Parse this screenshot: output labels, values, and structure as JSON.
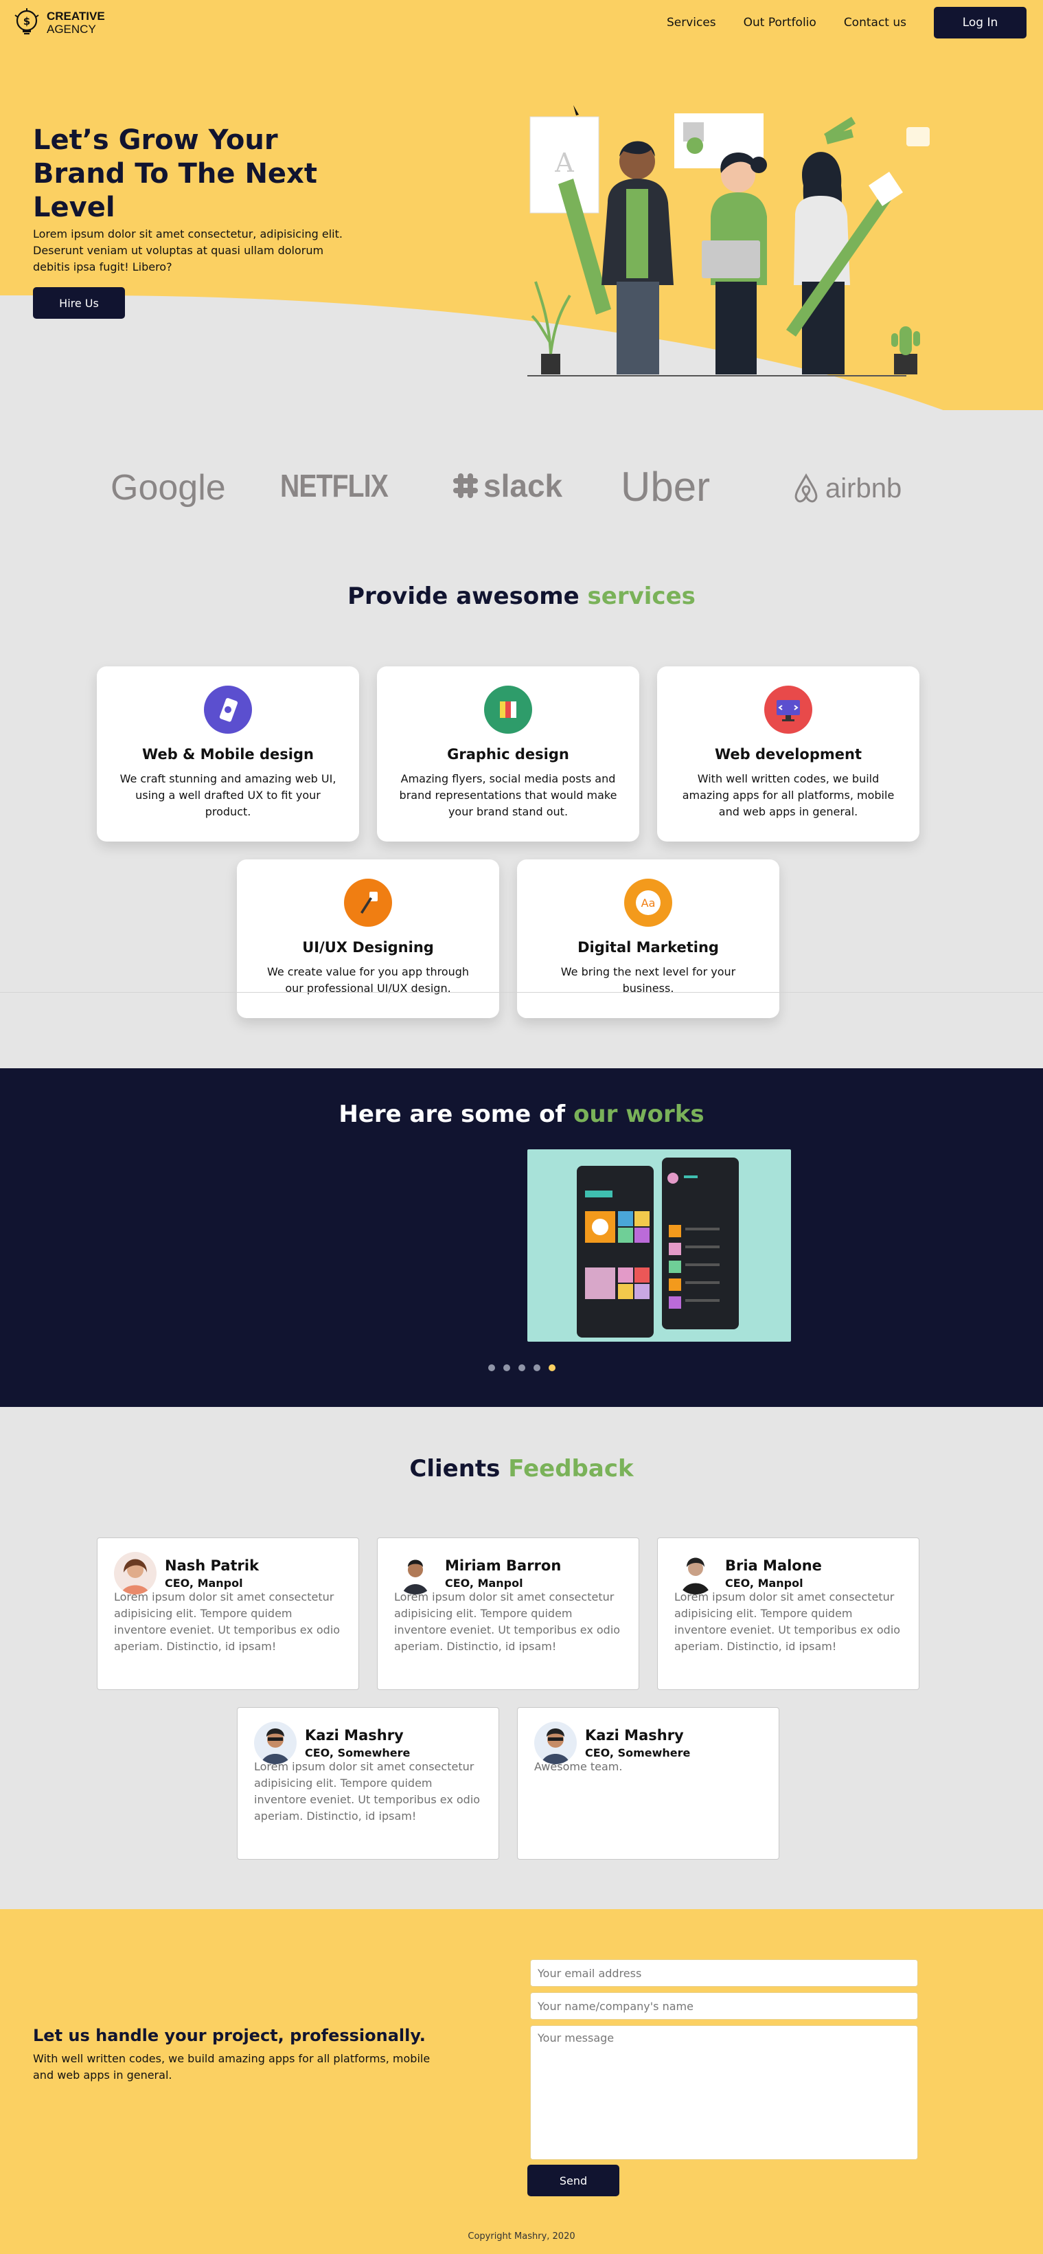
{
  "colors": {
    "primary": "#fbd062",
    "dark": "#111430",
    "accent": "#7ab259",
    "background": "#e5e5e5"
  },
  "brand": {
    "line1": "CREATIVE",
    "line2": "AGENCY",
    "icon": "lightbulb-logo-icon"
  },
  "nav": {
    "links": [
      "Services",
      "Out Portfolio",
      "Contact us"
    ],
    "login": "Log In"
  },
  "hero": {
    "title": "Let’s Grow Your Brand To The Next Level",
    "text": "Lorem ipsum dolor sit amet consectetur, adipisicing elit. Deserunt veniam ut voluptas at quasi ullam dolorum debitis ipsa fugit! Libero?",
    "button": "Hire Us"
  },
  "brands": [
    "Google",
    "NETFLIX",
    "slack",
    "Uber",
    "airbnb"
  ],
  "services": {
    "title_main": "Provide awesome ",
    "title_accent": "services",
    "items": [
      {
        "title": "Web & Mobile design",
        "text": "We craft stunning and amazing web UI, using a well drafted UX to fit your product.",
        "icon": "mobile-design-icon",
        "color": "#5b4fcf"
      },
      {
        "title": "Graphic design",
        "text": "Amazing flyers, social media posts and brand representations that would make your brand stand out.",
        "icon": "color-palette-icon",
        "color": "#2e9c6a"
      },
      {
        "title": "Web development",
        "text": "With well written codes, we build amazing apps for all platforms, mobile and web apps in general.",
        "icon": "code-monitor-icon",
        "color": "#e84a4a"
      },
      {
        "title": "UI/UX Designing",
        "text": "We create value for you app through our professional UI/UX design.",
        "icon": "pen-tool-icon",
        "color": "#f07e12"
      },
      {
        "title": "Digital Marketing",
        "text": "We bring the next level for your business.",
        "icon": "font-aa-icon",
        "color": "#f39a1c"
      }
    ]
  },
  "works": {
    "title_main": "Here are some of ",
    "title_accent": "our works",
    "slides": 5,
    "active_slide": 5
  },
  "feedback": {
    "title_main": "Clients ",
    "title_accent": "Feedback",
    "items": [
      {
        "name": "Nash Patrik",
        "role": "CEO, Manpol",
        "text": "Lorem ipsum dolor sit amet consectetur adipisicing elit. Tempore quidem inventore eveniet. Ut temporibus ex odio aperiam. Distinctio, id ipsam!"
      },
      {
        "name": "Miriam Barron",
        "role": "CEO, Manpol",
        "text": "Lorem ipsum dolor sit amet consectetur adipisicing elit. Tempore quidem inventore eveniet. Ut temporibus ex odio aperiam. Distinctio, id ipsam!"
      },
      {
        "name": "Bria Malone",
        "role": "CEO, Manpol",
        "text": "Lorem ipsum dolor sit amet consectetur adipisicing elit. Tempore quidem inventore eveniet. Ut temporibus ex odio aperiam. Distinctio, id ipsam!"
      },
      {
        "name": "Kazi Mashry",
        "role": "CEO, Somewhere",
        "text": "Lorem ipsum dolor sit amet consectetur adipisicing elit. Tempore quidem inventore eveniet. Ut temporibus ex odio aperiam. Distinctio, id ipsam!"
      },
      {
        "name": "Kazi Mashry",
        "role": "CEO, Somewhere",
        "text": "Awesome team."
      }
    ]
  },
  "contact": {
    "title": "Let us handle your project, professionally.",
    "text": "With well written codes, we build amazing apps for all platforms, mobile and web apps in general.",
    "email_placeholder": "Your email address",
    "name_placeholder": "Your name/company's name",
    "message_placeholder": "Your message",
    "send": "Send",
    "copyright": "Copyright Mashry, 2020"
  }
}
